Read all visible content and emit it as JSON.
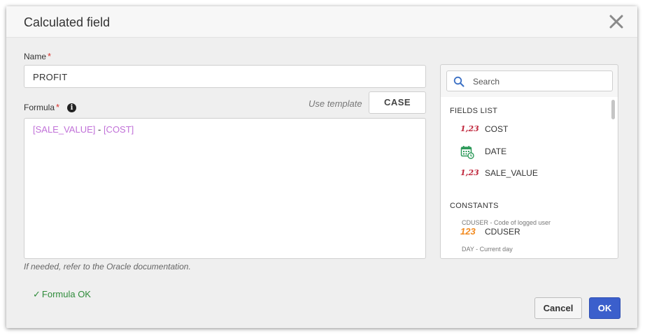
{
  "dialog": {
    "title": "Calculated field",
    "name_label": "Name",
    "name_value": "PROFIT",
    "formula_label": "Formula",
    "required_mark": "*",
    "info_glyph": "i",
    "use_template_label": "Use template",
    "case_button": "CASE",
    "formula_tokens": {
      "field1": "[SALE_VALUE]",
      "operator": " - ",
      "field2": "[COST]"
    },
    "hint": "If needed, refer to the Oracle documentation.",
    "status": "Formula OK",
    "status_check": "✓",
    "cancel_button": "Cancel",
    "ok_button": "OK"
  },
  "fields_panel": {
    "search_placeholder": "Search",
    "fields_title": "FIELDS LIST",
    "fields": [
      {
        "icon": "number-icon",
        "icon_text": "1,23",
        "label": "COST"
      },
      {
        "icon": "calendar-icon",
        "label": "DATE"
      },
      {
        "icon": "number-icon",
        "icon_text": "1,23",
        "label": "SALE_VALUE"
      }
    ],
    "constants_title": "CONSTANTS",
    "constants": [
      {
        "description": "CDUSER - Code of logged user",
        "icon_text": "123",
        "label": "CDUSER"
      },
      {
        "description": "DAY - Current day"
      }
    ]
  },
  "colors": {
    "field_token": "#c171d8",
    "ok_button": "#3b5fcc",
    "status_ok": "#2e8b3a",
    "required": "#d9302b",
    "number_icon": "#c0283d",
    "constant_icon": "#f28a1f",
    "calendar_icon": "#2e9a5a"
  }
}
